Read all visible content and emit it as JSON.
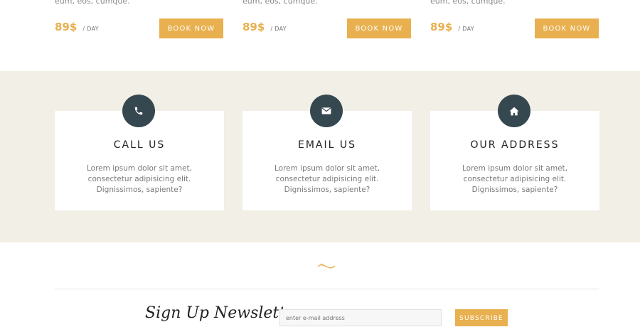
{
  "rooms": [
    {
      "desc": "eum, eos, cumque.",
      "price": "89$",
      "unit": "/ DAY",
      "button": "BOOK NOW"
    },
    {
      "desc": "eum, eos, cumque.",
      "price": "89$",
      "unit": "/ DAY",
      "button": "BOOK NOW"
    },
    {
      "desc": "eum, eos, cumque.",
      "price": "89$",
      "unit": "/ DAY",
      "button": "BOOK NOW"
    }
  ],
  "contact": [
    {
      "icon": "phone-icon",
      "title": "CALL US",
      "text": "Lorem ipsum dolor sit amet, consectetur adipisicing elit. Dignissimos, sapiente?"
    },
    {
      "icon": "envelope-icon",
      "title": "EMAIL US",
      "text": "Lorem ipsum dolor sit amet, consectetur adipisicing elit. Dignissimos, sapiente?"
    },
    {
      "icon": "home-icon",
      "title": "OUR ADDRESS",
      "text": "Lorem ipsum dolor sit amet, consectetur adipisicing elit. Dignissimos, sapiente?"
    }
  ],
  "newsletter": {
    "title": "Sign Up Newsletter",
    "placeholder": "enter e-mail address",
    "button": "SUBSCRIBE"
  },
  "colors": {
    "accent": "#e8b04f",
    "icon_circle": "#35474f",
    "section_bg": "#f1efe6"
  }
}
